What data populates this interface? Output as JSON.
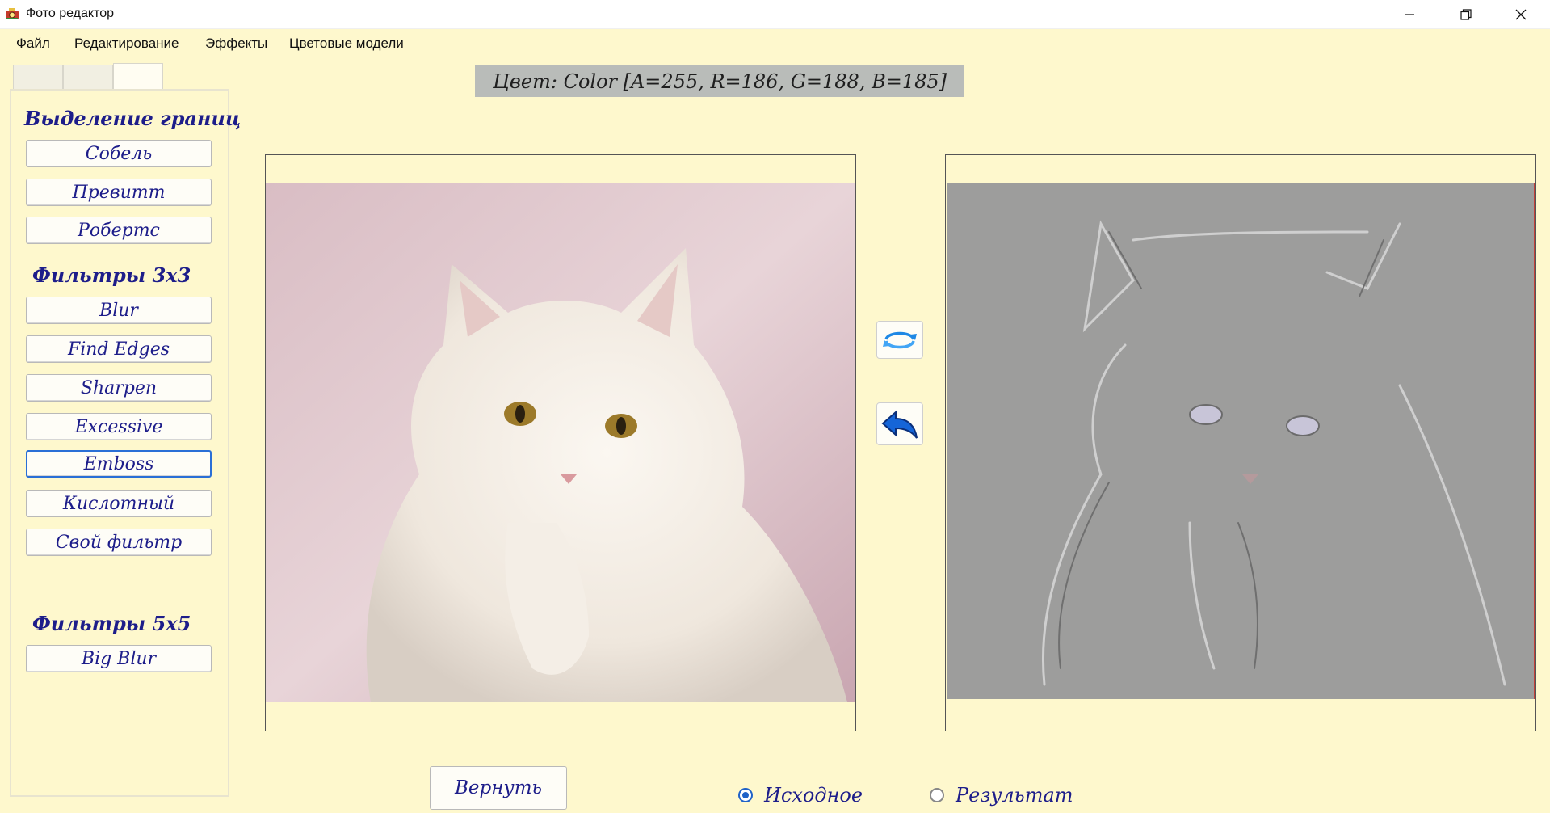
{
  "window": {
    "title": "Фото редактор",
    "icon": "photo-app-icon"
  },
  "menu": [
    "Файл",
    "Редактирование",
    "Эффекты",
    "Цветовые модели"
  ],
  "tabs": [
    "",
    "",
    ""
  ],
  "color_info": "Цвет: Color [A=255, R=186, G=188, B=185]",
  "sections": {
    "edges": {
      "title": "Выделение границ",
      "buttons": [
        "Собель",
        "Превитт",
        "Робертс"
      ]
    },
    "filters3": {
      "title": "Фильтры 3x3",
      "buttons": [
        "Blur",
        "Find Edges",
        "Sharpen",
        "Excessive",
        "Emboss",
        "Кислотный",
        "Свой фильтр"
      ]
    },
    "filters5": {
      "title": "Фильтры 5x5",
      "buttons": [
        "Big Blur"
      ]
    }
  },
  "images": {
    "original": "white-cat-photo",
    "result": "white-cat-emboss-result"
  },
  "actions": {
    "undo_label": "Вернуть",
    "swap_icon": "rotate-arrows-icon",
    "back_icon": "back-arrow-icon"
  },
  "view_options": {
    "selected": "Исходное",
    "options": [
      "Исходное",
      "Результат"
    ]
  },
  "colors": {
    "accent": "#1d1d8a",
    "background": "#fef8cd",
    "focus": "#2a6fd6"
  }
}
